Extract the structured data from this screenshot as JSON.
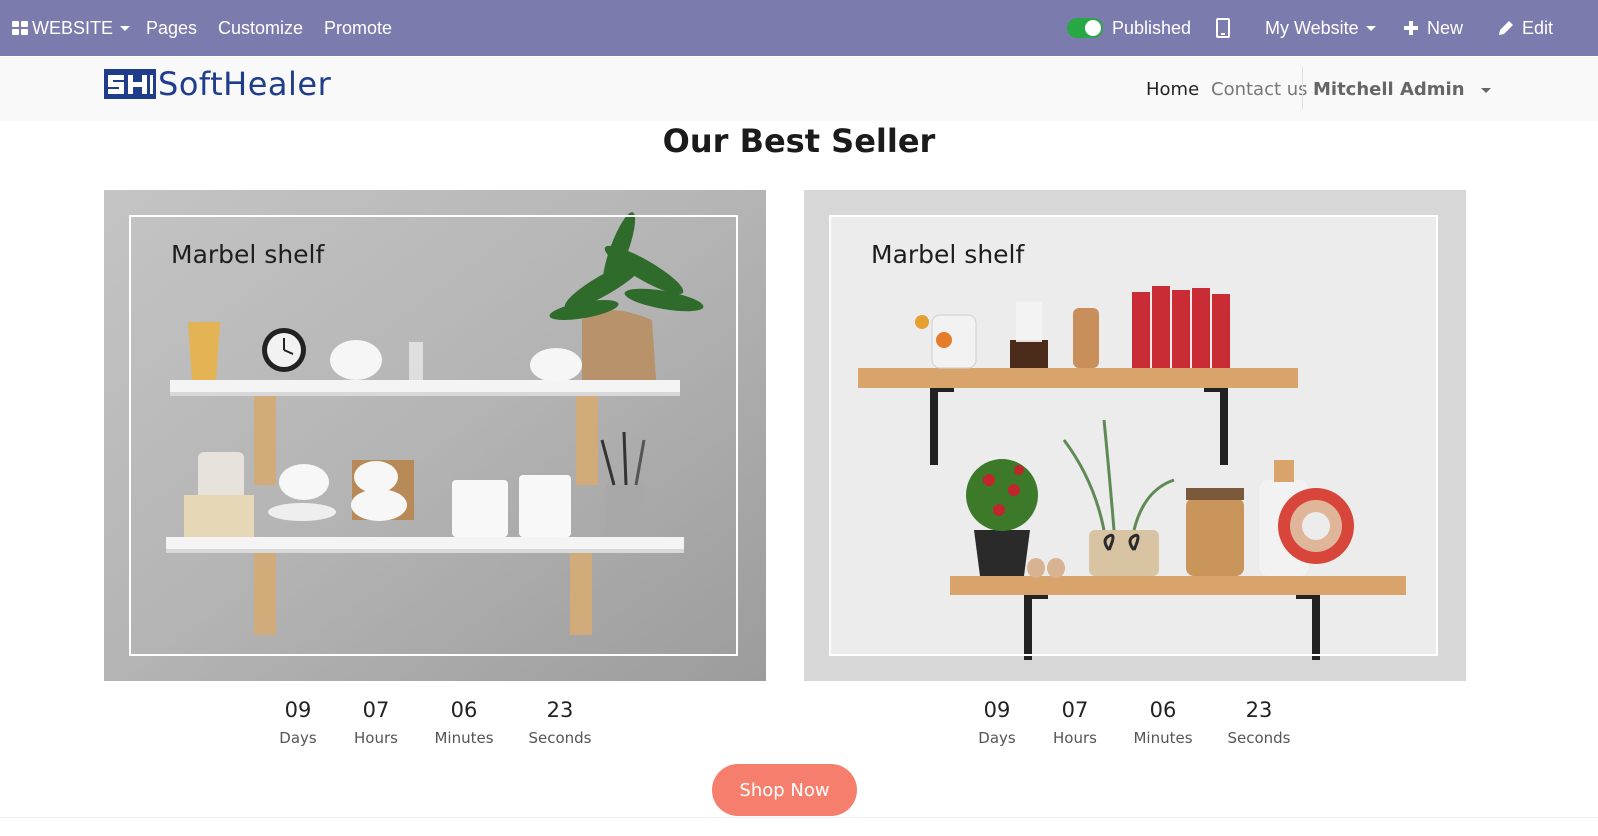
{
  "editor_bar": {
    "website_label": "WEBSITE",
    "menu": [
      "Pages",
      "Customize",
      "Promote"
    ],
    "published_label": "Published",
    "published": true,
    "site_selector": "My Website",
    "new_label": "New",
    "edit_label": "Edit",
    "background_color": "#7c7bad"
  },
  "header": {
    "logo_text": "SoftHealer",
    "nav": [
      "Home",
      "Contact us"
    ],
    "user": "Mitchell Admin"
  },
  "section": {
    "title": "Our Best Seller"
  },
  "products": [
    {
      "title": "Marbel shelf",
      "countdown": [
        {
          "value": "09",
          "label": "Days"
        },
        {
          "value": "07",
          "label": "Hours"
        },
        {
          "value": "06",
          "label": "Minutes"
        },
        {
          "value": "23",
          "label": "Seconds"
        }
      ]
    },
    {
      "title": "Marbel shelf",
      "countdown": [
        {
          "value": "09",
          "label": "Days"
        },
        {
          "value": "07",
          "label": "Hours"
        },
        {
          "value": "06",
          "label": "Minutes"
        },
        {
          "value": "23",
          "label": "Seconds"
        }
      ]
    }
  ],
  "cta": {
    "label": "Shop Now",
    "color": "#f57f6c"
  }
}
